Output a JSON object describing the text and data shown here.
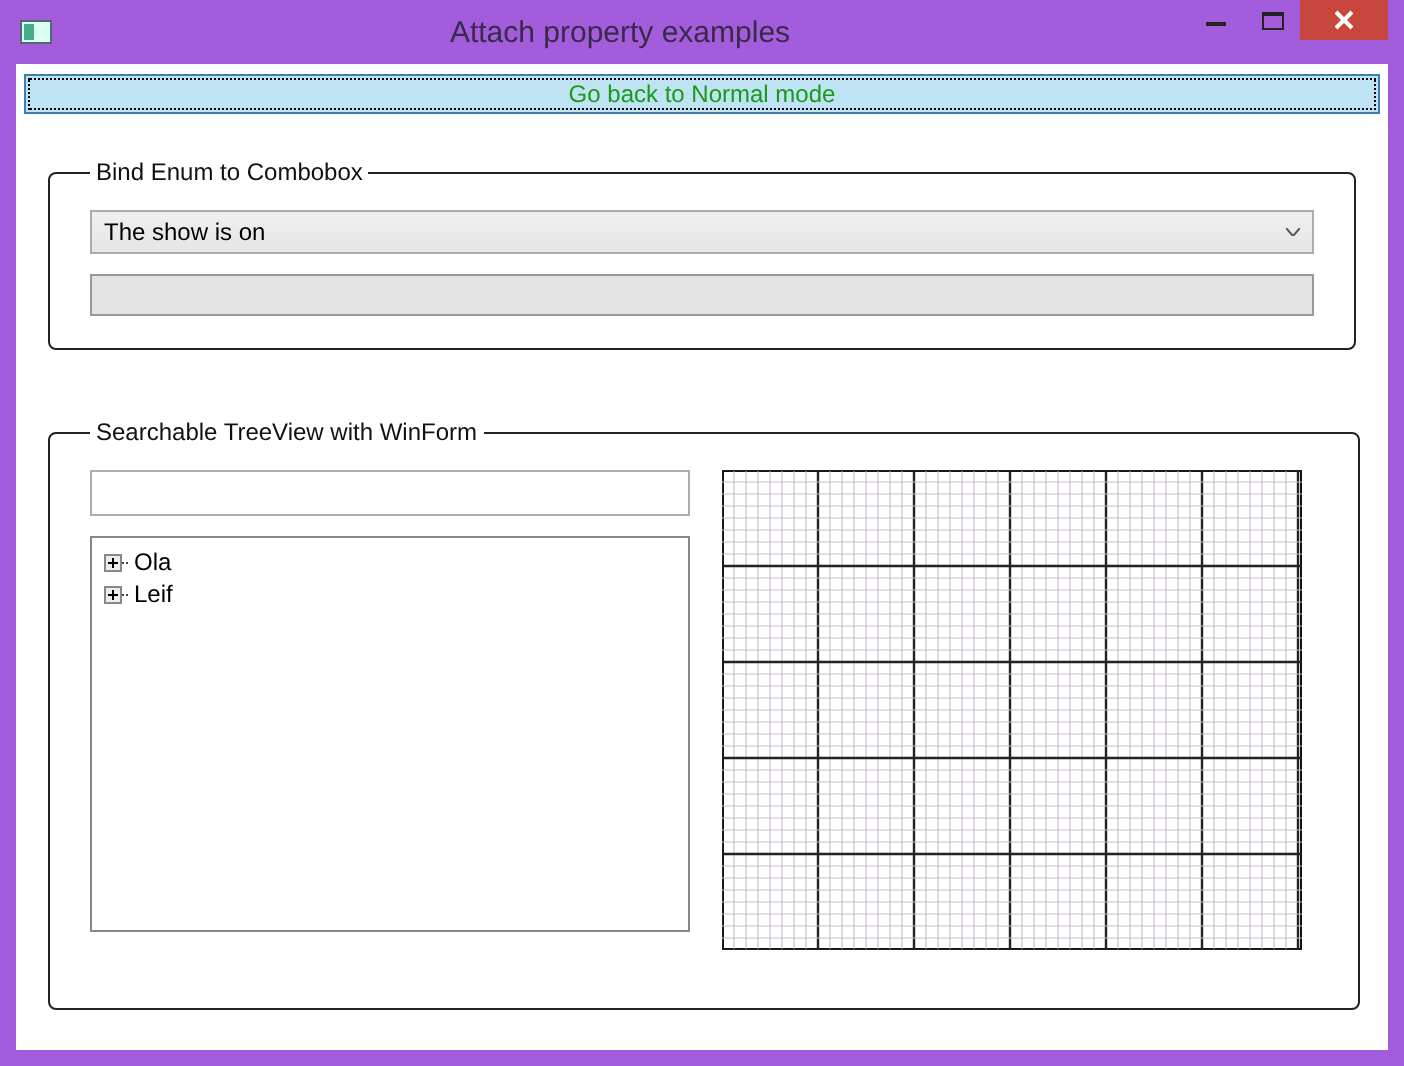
{
  "window": {
    "title": "Attach property examples"
  },
  "mode_button": {
    "label": "Go back to Normal mode"
  },
  "enum_group": {
    "title": "Bind Enum to Combobox",
    "combobox": {
      "value": "The show is on"
    }
  },
  "tree_group": {
    "title": "Searchable TreeView with WinForm",
    "tree": [
      {
        "label": "Ola",
        "expanded": false
      },
      {
        "label": "Leif",
        "expanded": false
      }
    ]
  }
}
